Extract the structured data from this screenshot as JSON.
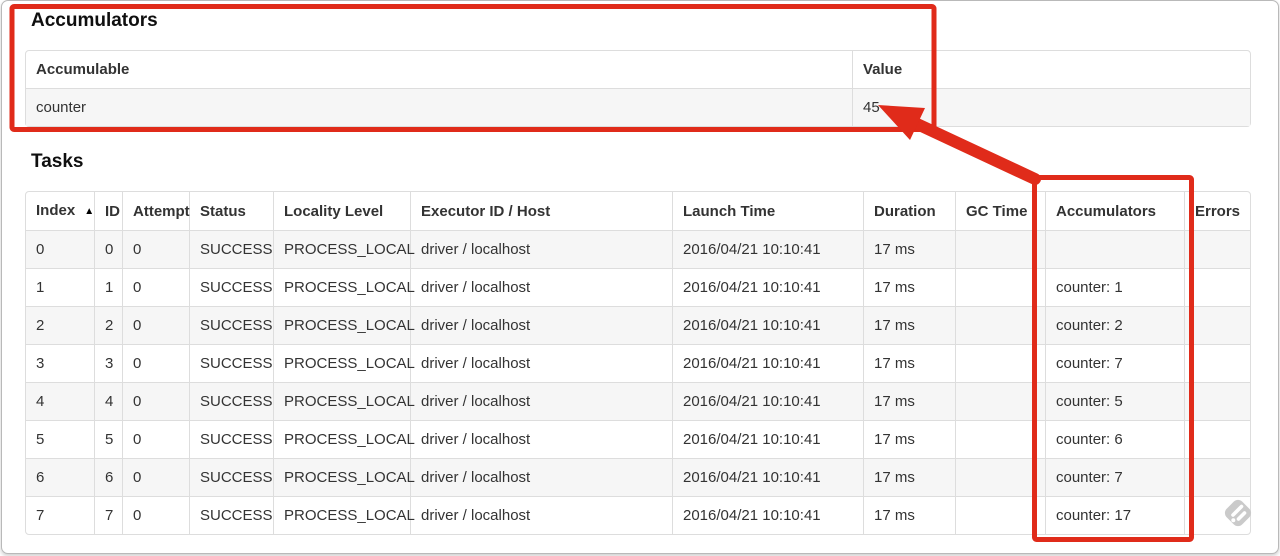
{
  "colors": {
    "annotation_red": "#e02b1a",
    "table_border": "#dddddd",
    "stripe_bg": "#f6f6f6",
    "text": "#333333",
    "watermark_gray": "#cacaca"
  },
  "accumulators_section": {
    "title": "Accumulators",
    "table": {
      "columns": [
        {
          "key": "accumulable",
          "label": "Accumulable"
        },
        {
          "key": "value",
          "label": "Value"
        }
      ],
      "rows": [
        {
          "accumulable": "counter",
          "value": "45"
        }
      ]
    }
  },
  "tasks_section": {
    "title": "Tasks",
    "table": {
      "sort_icon": "▲",
      "columns": [
        {
          "key": "index",
          "label": "Index",
          "sorted": true
        },
        {
          "key": "id",
          "label": "ID"
        },
        {
          "key": "attempt",
          "label": "Attempt"
        },
        {
          "key": "status",
          "label": "Status"
        },
        {
          "key": "locality_level",
          "label": "Locality Level"
        },
        {
          "key": "executor_id_host",
          "label": "Executor ID / Host"
        },
        {
          "key": "launch_time",
          "label": "Launch Time"
        },
        {
          "key": "duration",
          "label": "Duration"
        },
        {
          "key": "gc_time",
          "label": "GC Time"
        },
        {
          "key": "accumulators",
          "label": "Accumulators"
        },
        {
          "key": "errors",
          "label": "Errors"
        }
      ],
      "rows": [
        {
          "index": "0",
          "id": "0",
          "attempt": "0",
          "status": "SUCCESS",
          "locality_level": "PROCESS_LOCAL",
          "executor_id_host": "driver / localhost",
          "launch_time": "2016/04/21 10:10:41",
          "duration": "17 ms",
          "gc_time": "",
          "accumulators": "",
          "errors": ""
        },
        {
          "index": "1",
          "id": "1",
          "attempt": "0",
          "status": "SUCCESS",
          "locality_level": "PROCESS_LOCAL",
          "executor_id_host": "driver / localhost",
          "launch_time": "2016/04/21 10:10:41",
          "duration": "17 ms",
          "gc_time": "",
          "accumulators": "counter: 1",
          "errors": ""
        },
        {
          "index": "2",
          "id": "2",
          "attempt": "0",
          "status": "SUCCESS",
          "locality_level": "PROCESS_LOCAL",
          "executor_id_host": "driver / localhost",
          "launch_time": "2016/04/21 10:10:41",
          "duration": "17 ms",
          "gc_time": "",
          "accumulators": "counter: 2",
          "errors": ""
        },
        {
          "index": "3",
          "id": "3",
          "attempt": "0",
          "status": "SUCCESS",
          "locality_level": "PROCESS_LOCAL",
          "executor_id_host": "driver / localhost",
          "launch_time": "2016/04/21 10:10:41",
          "duration": "17 ms",
          "gc_time": "",
          "accumulators": "counter: 7",
          "errors": ""
        },
        {
          "index": "4",
          "id": "4",
          "attempt": "0",
          "status": "SUCCESS",
          "locality_level": "PROCESS_LOCAL",
          "executor_id_host": "driver / localhost",
          "launch_time": "2016/04/21 10:10:41",
          "duration": "17 ms",
          "gc_time": "",
          "accumulators": "counter: 5",
          "errors": ""
        },
        {
          "index": "5",
          "id": "5",
          "attempt": "0",
          "status": "SUCCESS",
          "locality_level": "PROCESS_LOCAL",
          "executor_id_host": "driver / localhost",
          "launch_time": "2016/04/21 10:10:41",
          "duration": "17 ms",
          "gc_time": "",
          "accumulators": "counter: 6",
          "errors": ""
        },
        {
          "index": "6",
          "id": "6",
          "attempt": "0",
          "status": "SUCCESS",
          "locality_level": "PROCESS_LOCAL",
          "executor_id_host": "driver / localhost",
          "launch_time": "2016/04/21 10:10:41",
          "duration": "17 ms",
          "gc_time": "",
          "accumulators": "counter: 7",
          "errors": ""
        },
        {
          "index": "7",
          "id": "7",
          "attempt": "0",
          "status": "SUCCESS",
          "locality_level": "PROCESS_LOCAL",
          "executor_id_host": "driver / localhost",
          "launch_time": "2016/04/21 10:10:41",
          "duration": "17 ms",
          "gc_time": "",
          "accumulators": "counter: 17",
          "errors": ""
        }
      ]
    }
  }
}
